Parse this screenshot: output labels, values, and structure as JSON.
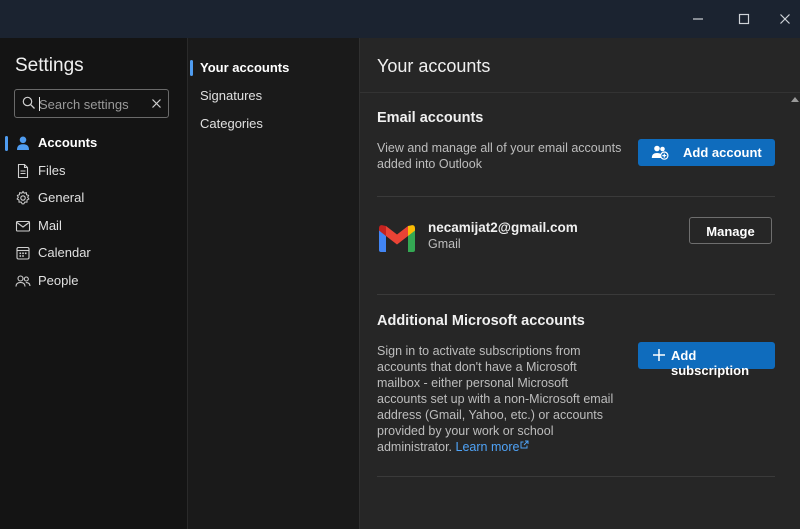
{
  "window": {
    "minimize_icon": "minimize-icon",
    "maximize_icon": "maximize-icon",
    "close_icon": "close-icon"
  },
  "left_nav": {
    "title": "Settings",
    "search": {
      "placeholder": "Search settings",
      "value": ""
    },
    "items": [
      {
        "label": "Accounts",
        "icon": "person-icon",
        "selected": true
      },
      {
        "label": "Files",
        "icon": "document-icon",
        "selected": false
      },
      {
        "label": "General",
        "icon": "gear-icon",
        "selected": false
      },
      {
        "label": "Mail",
        "icon": "mail-icon",
        "selected": false
      },
      {
        "label": "Calendar",
        "icon": "calendar-icon",
        "selected": false
      },
      {
        "label": "People",
        "icon": "people-icon",
        "selected": false
      }
    ]
  },
  "sub_nav": {
    "items": [
      {
        "label": "Your accounts",
        "selected": true
      },
      {
        "label": "Signatures",
        "selected": false
      },
      {
        "label": "Categories",
        "selected": false
      }
    ]
  },
  "main": {
    "title": "Your accounts",
    "email_accounts": {
      "heading": "Email accounts",
      "description_line1": "View and manage all of your email accounts",
      "description_line2": "added into Outlook",
      "add_button_label": "Add account"
    },
    "account": {
      "email": "necamijat2@gmail.com",
      "type": "Gmail",
      "manage_button_label": "Manage"
    },
    "additional": {
      "heading": "Additional Microsoft accounts",
      "description_lines": [
        "Sign in to activate subscriptions from",
        "accounts that don't have a Microsoft",
        "mailbox - either personal Microsoft",
        "accounts set up with a non-Microsoft email",
        "address (Gmail, Yahoo, etc.) or accounts",
        "provided by your work or school"
      ],
      "description_last_prefix": "administrator.",
      "learn_more_label": "Learn more",
      "add_subscription_label": "Add subscription"
    }
  },
  "colors": {
    "accent": "#0f6cbd",
    "selection_bar": "#4f9cf0",
    "link": "#4fa3f7"
  }
}
